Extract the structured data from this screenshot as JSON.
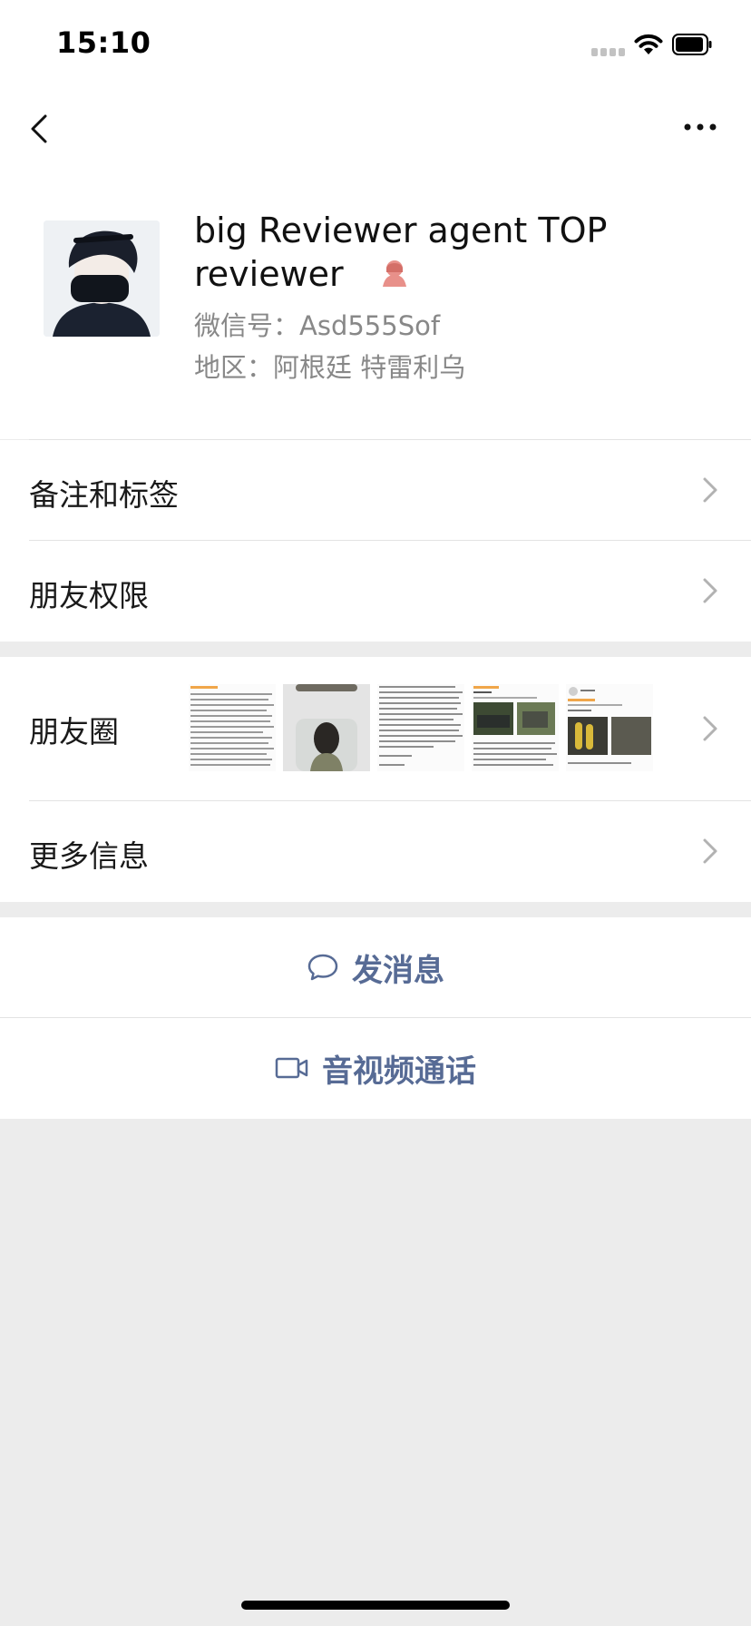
{
  "status_bar": {
    "time": "15:10"
  },
  "profile": {
    "name": "big Reviewer agent TOP reviewer",
    "wechat_id": "微信号：Asd555Sof",
    "region": "地区：阿根廷 特雷利乌"
  },
  "rows": {
    "remark_tags": "备注和标签",
    "friend_permissions": "朋友权限",
    "moments": "朋友圈",
    "more_info": "更多信息"
  },
  "actions": {
    "send_message": "发消息",
    "video_call": "音视频通话"
  },
  "colors": {
    "link": "#576b95",
    "background": "#ececec",
    "badge": "#e8908a"
  },
  "icons": {
    "back": "back-chevron-icon",
    "more": "more-dots-icon",
    "message": "chat-bubble-icon",
    "video": "video-camera-icon"
  }
}
